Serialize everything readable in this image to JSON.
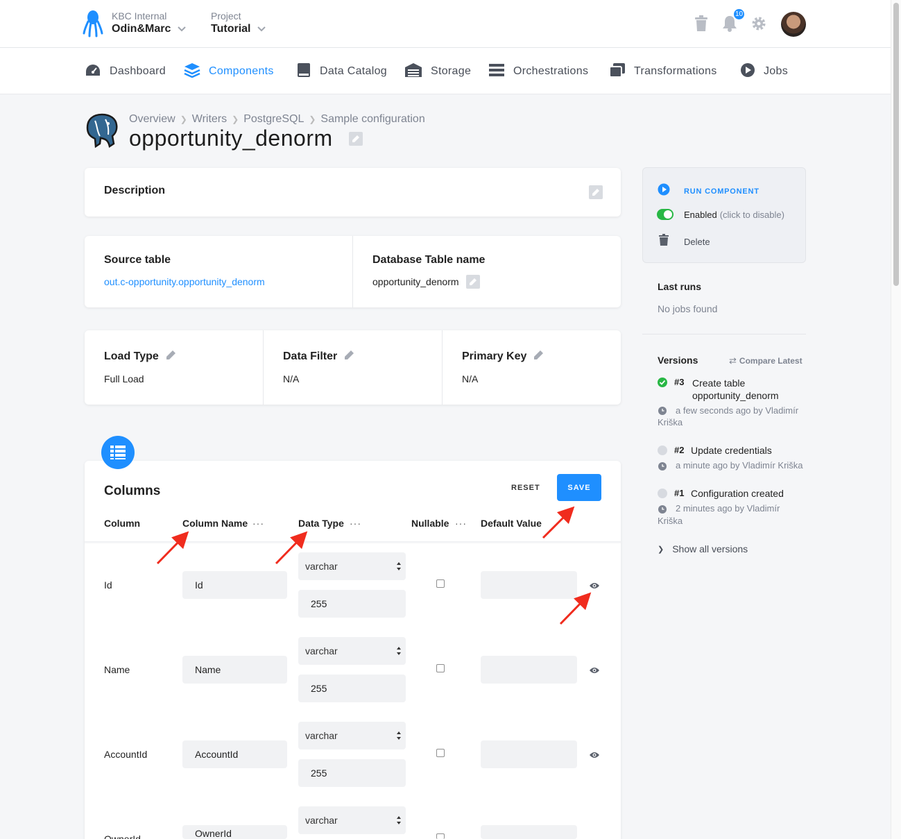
{
  "header": {
    "org_label": "KBC Internal",
    "org_name": "Odin&Marc",
    "project_label": "Project",
    "project_name": "Tutorial",
    "notification_count": "10"
  },
  "nav": {
    "items": [
      {
        "label": "Dashboard",
        "icon": "dashboard-icon"
      },
      {
        "label": "Components",
        "icon": "layers-icon"
      },
      {
        "label": "Data Catalog",
        "icon": "book-icon"
      },
      {
        "label": "Storage",
        "icon": "warehouse-icon"
      },
      {
        "label": "Orchestrations",
        "icon": "bars-icon"
      },
      {
        "label": "Transformations",
        "icon": "copy-icon"
      },
      {
        "label": "Jobs",
        "icon": "play-circle-icon"
      }
    ],
    "active": "Components"
  },
  "breadcrumb": {
    "items": [
      "Overview",
      "Writers",
      "PostgreSQL",
      "Sample configuration"
    ]
  },
  "page_title": "opportunity_denorm",
  "description": {
    "label": "Description"
  },
  "source": {
    "source_label": "Source table",
    "source_value": "out.c-opportunity.opportunity_denorm",
    "db_label": "Database Table name",
    "db_value": "opportunity_denorm"
  },
  "load": {
    "load_type_label": "Load Type",
    "load_type_value": "Full Load",
    "data_filter_label": "Data Filter",
    "data_filter_value": "N/A",
    "primary_key_label": "Primary Key",
    "primary_key_value": "N/A"
  },
  "columns": {
    "title": "Columns",
    "reset_label": "RESET",
    "save_label": "SAVE",
    "headers": {
      "column": "Column",
      "column_name": "Column Name",
      "data_type": "Data Type",
      "nullable": "Nullable",
      "default_value": "Default Value"
    },
    "dots": "···",
    "rows": [
      {
        "column": "Id",
        "name": "Id",
        "type": "varchar",
        "length": "255"
      },
      {
        "column": "Name",
        "name": "Name",
        "type": "varchar",
        "length": "255"
      },
      {
        "column": "AccountId",
        "name": "AccountId",
        "type": "varchar",
        "length": "255"
      },
      {
        "column": "OwnerId",
        "name": "OwnerId",
        "type": "varchar",
        "length": ""
      }
    ]
  },
  "sidebar": {
    "run_label": "RUN COMPONENT",
    "enabled_label": "Enabled",
    "enabled_hint": "(click to disable)",
    "delete_label": "Delete",
    "last_runs_title": "Last runs",
    "last_runs_empty": "No jobs found",
    "versions_title": "Versions",
    "compare_label": "Compare Latest",
    "versions": [
      {
        "number": "#3",
        "title_line1": "Create table",
        "title_line2": "opportunity_denorm",
        "meta_line1": "a few seconds ago by Vladimír",
        "meta_line2": "Kriška"
      },
      {
        "number": "#2",
        "title_line1": "Update credentials",
        "meta_line1": "a minute ago by Vladimír Kriška"
      },
      {
        "number": "#1",
        "title_line1": "Configuration created",
        "meta_line1": "2 minutes ago by Vladimír",
        "meta_line2": "Kriška"
      }
    ],
    "show_all_label": "Show all versions"
  },
  "colors": {
    "accent": "#1f8fff",
    "success": "#28b745",
    "annotation_arrow": "#f02c1e"
  }
}
